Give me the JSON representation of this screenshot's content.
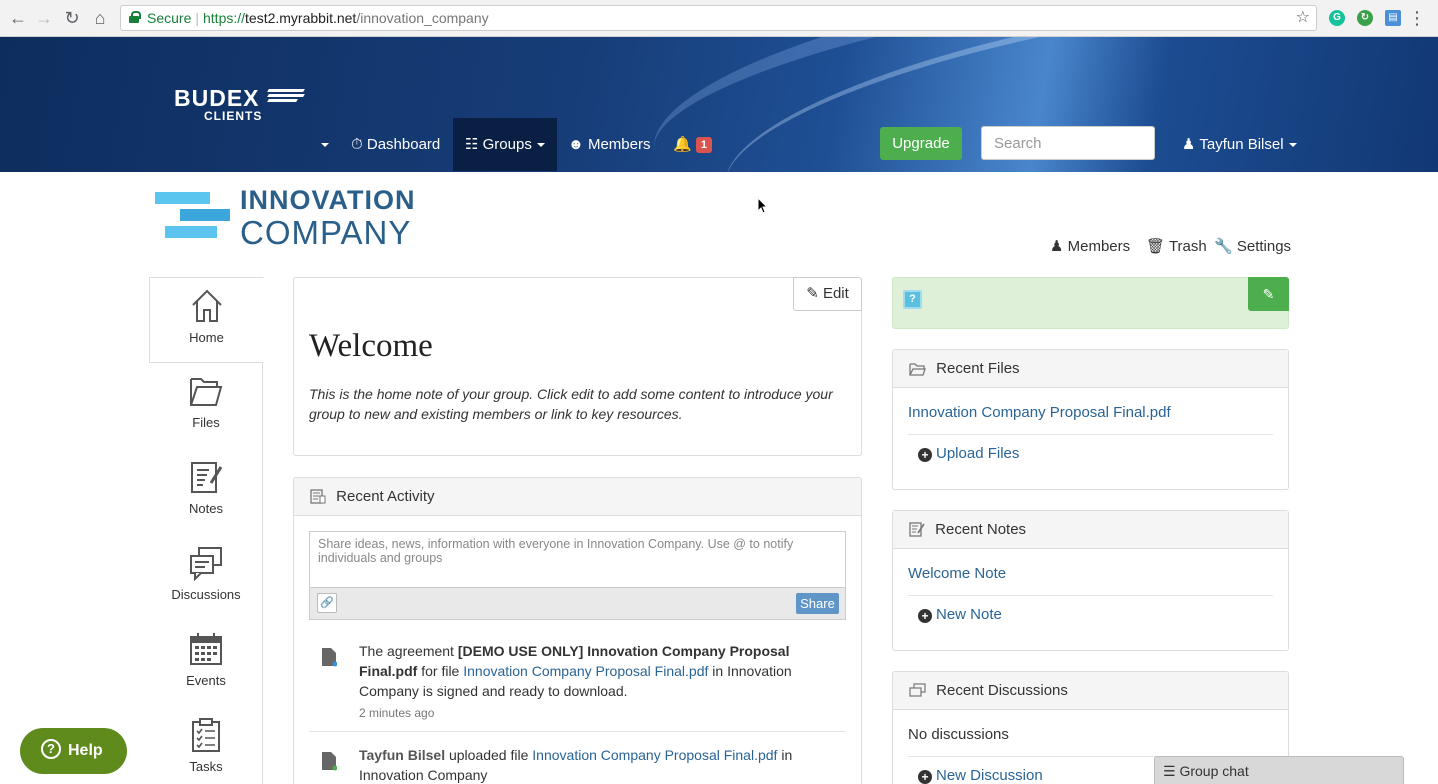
{
  "browser": {
    "secure_label": "Secure",
    "url_protocol": "https://",
    "url_host": "test2.myrabbit.net",
    "url_path": "/innovation_company"
  },
  "header": {
    "logo_line1": "BUDEX",
    "logo_line2": "CLIENTS",
    "nav": {
      "dashboard": "Dashboard",
      "groups": "Groups",
      "members": "Members",
      "notification_count": "1"
    },
    "upgrade_label": "Upgrade",
    "search_placeholder": "Search",
    "user_name": "Tayfun Bilsel"
  },
  "company": {
    "name_line1": "INNOVATION",
    "name_line2": "COMPANY",
    "links": {
      "members": "Members",
      "trash": "Trash",
      "settings": "Settings"
    }
  },
  "sidebar": {
    "items": [
      {
        "label": "Home"
      },
      {
        "label": "Files"
      },
      {
        "label": "Notes"
      },
      {
        "label": "Discussions"
      },
      {
        "label": "Events"
      },
      {
        "label": "Tasks"
      }
    ]
  },
  "welcome": {
    "edit_label": "Edit",
    "title": "Welcome",
    "text": "This is the home note of your group. Click edit to add some content to introduce your group to new and existing members or link to key resources."
  },
  "activity": {
    "title": "Recent Activity",
    "share_placeholder": "Share ideas, news, information with everyone in Innovation Company. Use @ to notify individuals and groups",
    "share_label": "Share",
    "items": [
      {
        "pre": "The agreement ",
        "bold": "[DEMO USE ONLY] Innovation Company Proposal Final.pdf",
        "mid": " for file ",
        "link": "Innovation Company Proposal Final.pdf",
        "post": " in Innovation Company is signed and ready to download.",
        "time": "2 minutes ago"
      },
      {
        "bold": "Tayfun Bilsel",
        "mid": " uploaded file ",
        "link": "Innovation Company Proposal Final.pdf",
        "post": " in Innovation Company"
      }
    ]
  },
  "right": {
    "files": {
      "title": "Recent Files",
      "item": "Innovation Company Proposal Final.pdf",
      "action": "Upload Files"
    },
    "notes": {
      "title": "Recent Notes",
      "item": "Welcome Note",
      "action": "New Note"
    },
    "discussions": {
      "title": "Recent Discussions",
      "empty": "No discussions",
      "action": "New Discussion"
    }
  },
  "help_label": "Help",
  "group_chat_label": "Group chat",
  "colors": {
    "header_dark": "#0d2d5e",
    "upgrade_green": "#4cae4c",
    "link_blue": "#2a6496",
    "info_green": "#dff0d8"
  }
}
